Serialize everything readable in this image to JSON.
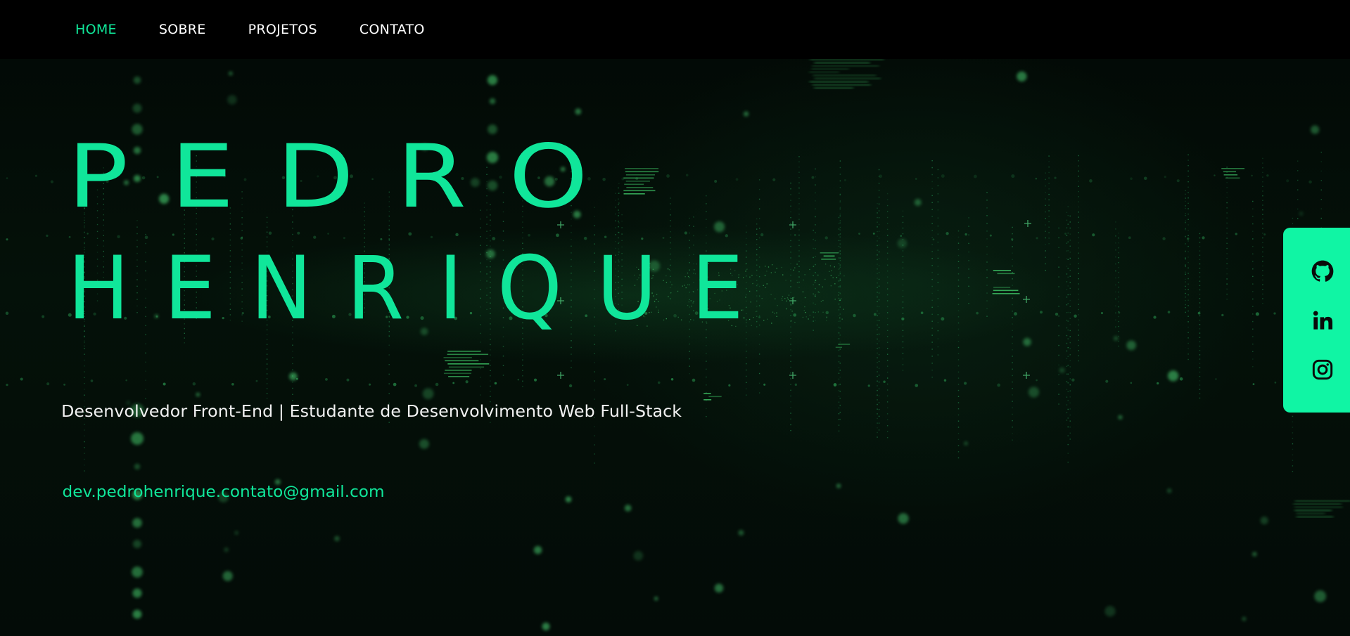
{
  "nav": {
    "items": [
      {
        "label": "HOME",
        "active": true
      },
      {
        "label": "SOBRE",
        "active": false
      },
      {
        "label": "PROJETOS",
        "active": false
      },
      {
        "label": "CONTATO",
        "active": false
      }
    ]
  },
  "hero": {
    "name_line1": "PEDRO",
    "name_line2": "HENRIQUE",
    "subtitle": "Desenvolvedor Front-End | Estudante de Desenvolvimento Web Full-Stack",
    "email": "dev.pedrohenrique.contato@gmail.com"
  },
  "social": {
    "icons": [
      "github-icon",
      "linkedin-icon",
      "instagram-icon"
    ]
  },
  "colors": {
    "accent": "#10e69a",
    "social_bar": "#10f5a4",
    "nav_bg": "#000000",
    "text": "#f2f2f2"
  }
}
